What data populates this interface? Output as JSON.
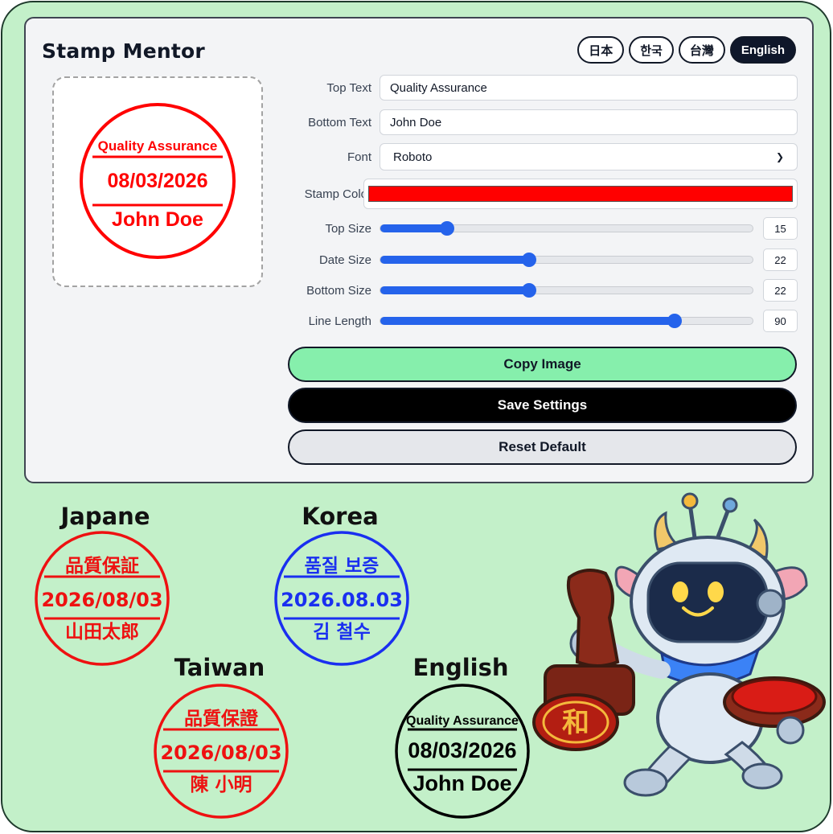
{
  "app": {
    "title": "Stamp Mentor"
  },
  "languages": [
    {
      "label": "日本",
      "active": false
    },
    {
      "label": "한국",
      "active": false
    },
    {
      "label": "台灣",
      "active": false
    },
    {
      "label": "English",
      "active": true
    }
  ],
  "preview": {
    "top": "Quality Assurance",
    "date": "08/03/2026",
    "bottom": "John Doe",
    "color": "#ff0000"
  },
  "form": {
    "top_text": {
      "label": "Top Text",
      "value": "Quality Assurance"
    },
    "bottom_text": {
      "label": "Bottom Text",
      "value": "John Doe"
    },
    "font": {
      "label": "Font",
      "value": "Roboto"
    },
    "stamp_color": {
      "label": "Stamp Color",
      "value": "#ff0000"
    },
    "sliders": [
      {
        "key": "top_size",
        "label": "Top Size",
        "value": 15,
        "fraction": 0.18
      },
      {
        "key": "date_size",
        "label": "Date Size",
        "value": 22,
        "fraction": 0.4
      },
      {
        "key": "bottom_size",
        "label": "Bottom Size",
        "value": 22,
        "fraction": 0.4
      },
      {
        "key": "line_length",
        "label": "Line Length",
        "value": 90,
        "fraction": 0.79
      }
    ]
  },
  "buttons": {
    "copy": "Copy Image",
    "save": "Save Settings",
    "reset": "Reset Default"
  },
  "samples": [
    {
      "title": "Japane",
      "top": "品質保証",
      "date": "2026/08/03",
      "bottom": "山田太郎",
      "color": "#ee1111"
    },
    {
      "title": "Korea",
      "top": "품질 보증",
      "date": "2026.08.03",
      "bottom": "김 철수",
      "color": "#1a2ff0"
    },
    {
      "title": "Taiwan",
      "top": "品質保證",
      "date": "2026/08/03",
      "bottom": "陳 小明",
      "color": "#ee1111"
    },
    {
      "title": "English",
      "top": "Quality Assurance",
      "date": "08/03/2026",
      "bottom": "John Doe",
      "color": "#000000"
    }
  ],
  "mascot": {
    "seal_char": "和"
  }
}
